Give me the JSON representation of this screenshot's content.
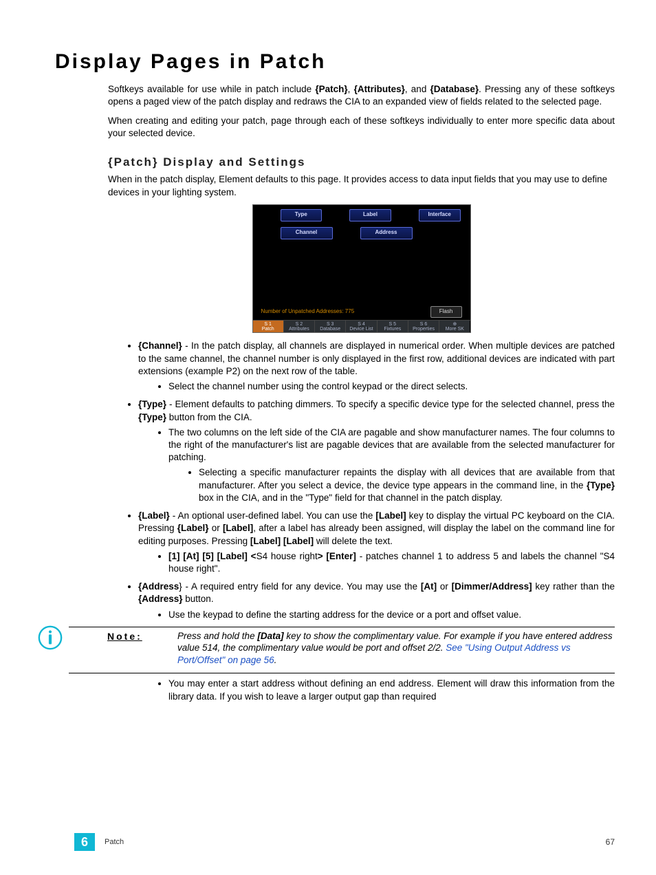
{
  "title": "Display Pages in Patch",
  "intro": {
    "p1_a": "Softkeys available for use while in patch include ",
    "p1_sk1": "{Patch}",
    "p1_b": ", ",
    "p1_sk2": "{Attributes}",
    "p1_c": ", and ",
    "p1_sk3": "{Database}",
    "p1_d": ". Pressing any of these softkeys opens a paged view of the patch display and redraws the CIA to an expanded view of fields related to the selected page.",
    "p2": "When creating and editing your patch, page through each of these softkeys individually to enter more specific data about your selected device."
  },
  "section2": {
    "heading": "{Patch} Display and Settings",
    "p1": "When in the patch display, Element defaults to this page. It provides access to data input fields that you may use to define devices in your lighting system."
  },
  "fig": {
    "row1": [
      "Type",
      "Label",
      "Interface"
    ],
    "row2": [
      "Channel",
      "Address"
    ],
    "status": "Number of Unpatched Addresses: 775",
    "flash": "Flash",
    "sk": [
      {
        "num": "S 1",
        "lab": "Patch",
        "sel": true
      },
      {
        "num": "S 2",
        "lab": "Attributes"
      },
      {
        "num": "S 3",
        "lab": "Database"
      },
      {
        "num": "S 4",
        "lab": "Device List"
      },
      {
        "num": "S 5",
        "lab": "Fixtures"
      },
      {
        "num": "S 6",
        "lab": "Properties"
      },
      {
        "num": "⊕",
        "lab": "More SK"
      }
    ]
  },
  "bullets": {
    "channel": {
      "lead": "{Channel}",
      "text": " - In the patch display, all channels are displayed in numerical order. When multiple devices are patched to the same channel, the channel number is only displayed in the first row, additional devices are indicated with part extensions (example P2) on the next row of the table.",
      "sub1": "Select the channel number using the control keypad or the direct selects."
    },
    "type": {
      "lead": "{Type}",
      "text_a": " - Element defaults to patching dimmers. To specify a specific device type for the selected channel, press the ",
      "text_b": "{Type}",
      "text_c": " button from the CIA.",
      "sub1": "The two columns on the left side of the CIA are pagable and show manufacturer names. The four columns to the right of the manufacturer's list are pagable devices that are available from the selected manufacturer for patching.",
      "subsub_a": "Selecting a specific manufacturer repaints the display with all devices that are available from that manufacturer. After you select a device, the device type appears in the command line, in the ",
      "subsub_b": "{Type}",
      "subsub_c": " box in the CIA, and in the \"Type\" field for that channel in the patch display."
    },
    "label": {
      "lead": "{Label}",
      "t1": " - An optional user-defined label. You can use the ",
      "k1": "[Label]",
      "t2": " key to display the virtual PC keyboard on the CIA. Pressing ",
      "k2": "{Label}",
      "t3": " or ",
      "k3": "[Label]",
      "t4": ", after a label has already been assigned, will display the label on the command line for editing purposes. Pressing ",
      "k4": "[Label] [Label]",
      "t5": " will delete the text.",
      "sub_k": "[1] [At] [5] [Label] <",
      "sub_mid": "S4 house right",
      "sub_k2": "> [Enter]",
      "sub_t": " - patches channel 1 to address 5 and labels the channel \"S4 house right\"."
    },
    "address": {
      "lead": "{Address",
      "brace": "}",
      "t1": " - A required entry field for any device. You may use the ",
      "k1": "[At]",
      "t2": " or ",
      "k2": "[Dimmer/Address]",
      "t3": " key rather than the ",
      "k3": "{Address}",
      "t4": " button.",
      "sub1": "Use the keypad to define the starting address for the device or a port and offset value.",
      "sub2": "You may enter a start address without defining an end address. Element will draw this information from the library data. If you wish to leave a larger output gap than required"
    }
  },
  "note": {
    "label": "Note:",
    "t1": "Press and hold the ",
    "k1": "[Data]",
    "t2": " key to show the complimentary value. For example if you have entered address value 514, the complimentary value would be port and offset 2/2. ",
    "link": "See \"Using Output Address vs Port/Offset\" on page 56",
    "t3": "."
  },
  "footer": {
    "chnum": "6",
    "chapter": "Patch",
    "page": "67"
  }
}
